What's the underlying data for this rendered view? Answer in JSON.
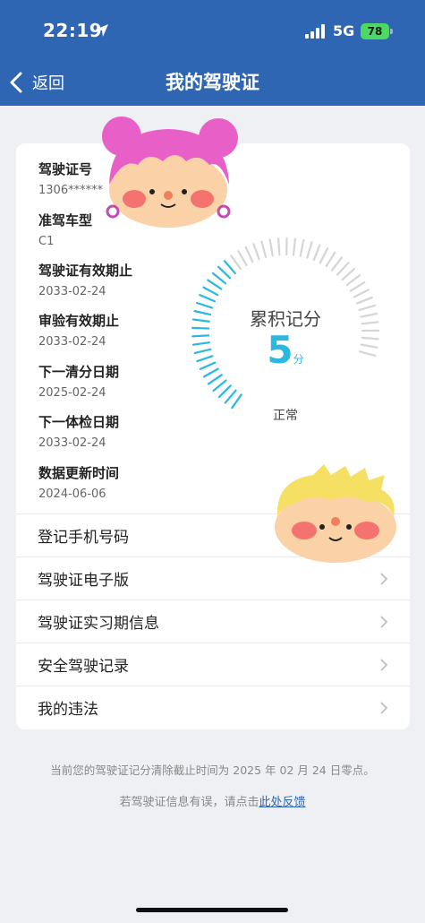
{
  "status_bar": {
    "time": "22:19",
    "network": "5G",
    "battery": "78"
  },
  "nav": {
    "back_label": "返回",
    "title": "我的驾驶证"
  },
  "license_info": [
    {
      "label": "驾驶证号",
      "value": "1306******"
    },
    {
      "label": "准驾车型",
      "value": "C1"
    },
    {
      "label": "驾驶证有效期止",
      "value": "2033-02-24"
    },
    {
      "label": "审验有效期止",
      "value": "2033-02-24"
    },
    {
      "label": "下一清分日期",
      "value": "2025-02-24"
    },
    {
      "label": "下一体检日期",
      "value": "2033-02-24"
    },
    {
      "label": "数据更新时间",
      "value": "2024-06-06"
    }
  ],
  "score_gauge": {
    "title": "累积记分",
    "score": "5",
    "unit": "分",
    "status": "正常",
    "max_points": 12,
    "accent_color": "#2ab7e0"
  },
  "menu": [
    {
      "label": "登记手机号码",
      "has_chevron": false
    },
    {
      "label": "驾驶证电子版",
      "has_chevron": true
    },
    {
      "label": "驾驶证实习期信息",
      "has_chevron": true
    },
    {
      "label": "安全驾驶记录",
      "has_chevron": true
    },
    {
      "label": "我的违法",
      "has_chevron": true
    }
  ],
  "footer": {
    "note": "当前您的驾驶证记分清除截止时间为 2025 年 02 月 24 日零点。",
    "feedback_prefix": "若驾驶证信息有误，请点击",
    "feedback_link": "此处反馈"
  },
  "colors": {
    "header_bg": "#2f66b3",
    "page_bg": "#eff0f4",
    "battery_green": "#4cd964"
  }
}
